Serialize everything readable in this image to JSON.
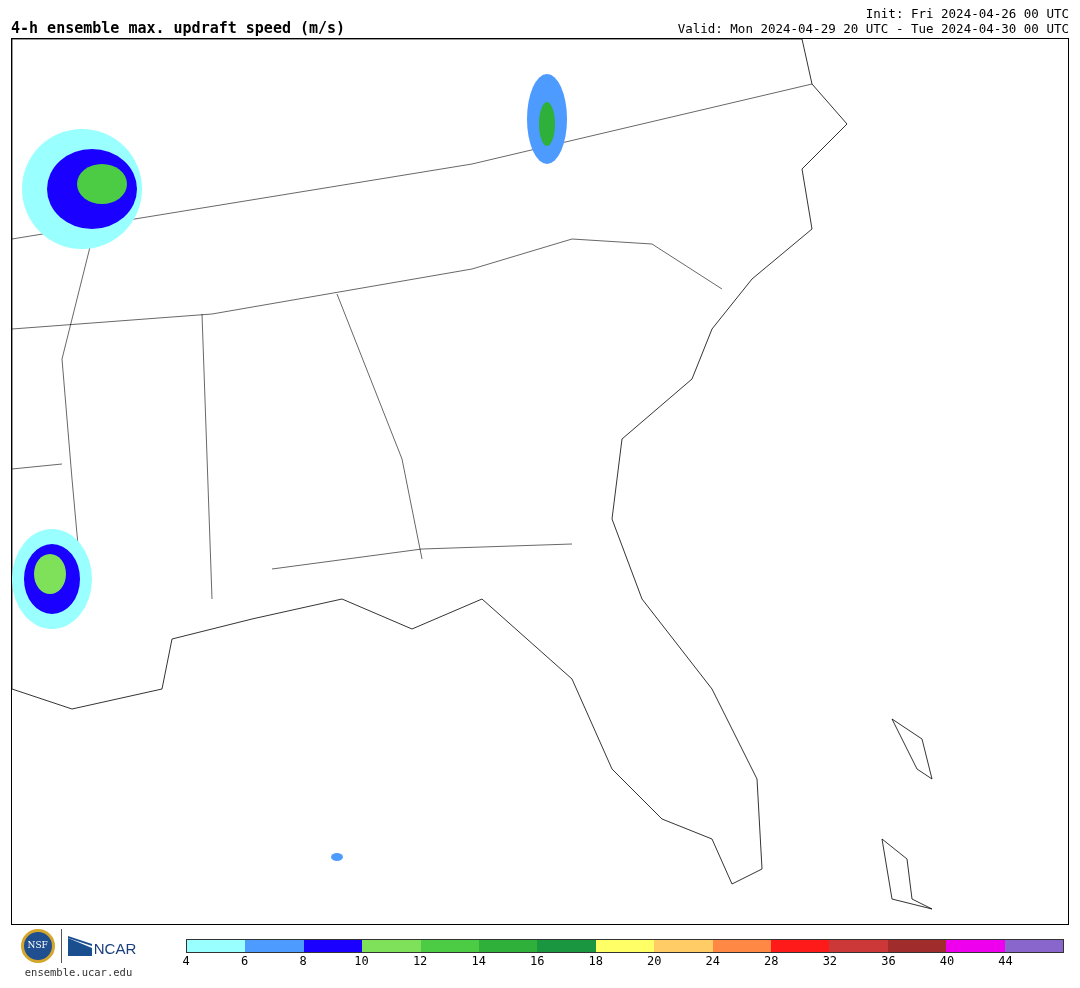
{
  "title": "4-h ensemble max. updraft speed (m/s)",
  "init": "Init: Fri 2024-04-26 00 UTC",
  "valid": "Valid: Mon 2024-04-29 20 UTC - Tue 2024-04-30 00 UTC",
  "logos": {
    "seal": "NSF",
    "org": "NCAR",
    "site": "ensemble.ucar.edu"
  },
  "colorbar": {
    "bins": [
      {
        "color": "#99ffff"
      },
      {
        "color": "#4d9bff"
      },
      {
        "color": "#1a00ff"
      },
      {
        "color": "#7fe05a"
      },
      {
        "color": "#4ccc44"
      },
      {
        "color": "#2eb03a"
      },
      {
        "color": "#1a9640"
      },
      {
        "color": "#ffff66"
      },
      {
        "color": "#ffcc66"
      },
      {
        "color": "#ff8844"
      },
      {
        "color": "#ff1a1a"
      },
      {
        "color": "#cc3838"
      },
      {
        "color": "#a02c2c"
      },
      {
        "color": "#ee00ee"
      },
      {
        "color": "#8866cc"
      }
    ],
    "ticks": [
      "4",
      "6",
      "8",
      "10",
      "12",
      "14",
      "16",
      "18",
      "20",
      "24",
      "28",
      "32",
      "36",
      "40",
      "44"
    ]
  }
}
